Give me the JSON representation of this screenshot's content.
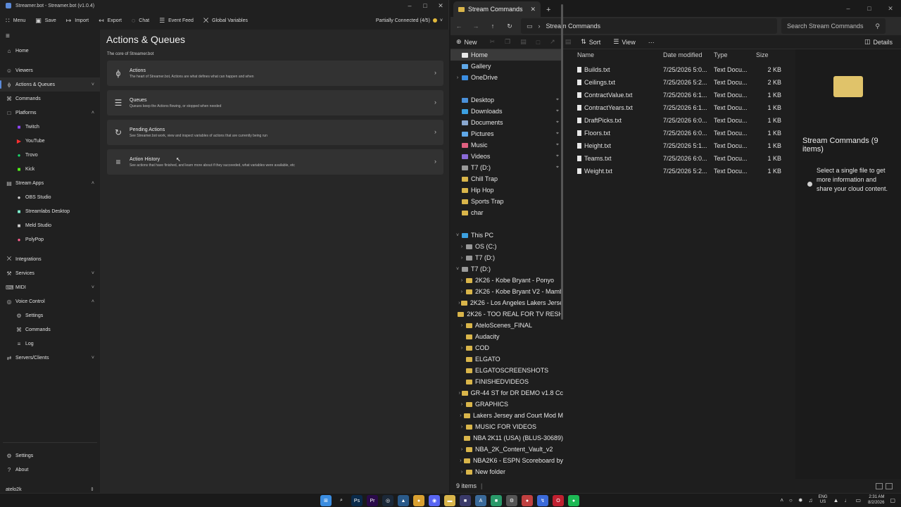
{
  "streamerbot": {
    "title": "Streamer.bot - Streamer.bot (v1.0.4)",
    "toolbar": [
      {
        "icon": "menu-icon",
        "glyph": "∷",
        "label": "Menu"
      },
      {
        "icon": "save-icon",
        "glyph": "▣",
        "label": "Save"
      },
      {
        "icon": "import-icon",
        "glyph": "↦",
        "label": "Import"
      },
      {
        "icon": "export-icon",
        "glyph": "↤",
        "label": "Export"
      },
      {
        "icon": "chat-icon",
        "glyph": "◌",
        "label": "Chat"
      },
      {
        "icon": "event-feed-icon",
        "glyph": "☰",
        "label": "Event Feed"
      },
      {
        "icon": "global-variables-icon",
        "glyph": "⨉",
        "label": "Global Variables"
      }
    ],
    "connection": "Partially Connected (4/5)",
    "sidebar": {
      "items": [
        {
          "key": "home",
          "label": "Home",
          "icon": "home-icon",
          "glyph": "⌂"
        },
        {
          "key": "gap"
        },
        {
          "key": "viewers",
          "label": "Viewers",
          "icon": "viewers-icon",
          "glyph": "☺"
        },
        {
          "key": "actions-queues",
          "label": "Actions & Queues",
          "icon": "actions-icon",
          "glyph": "ϕ",
          "chev": "˅",
          "active": true
        },
        {
          "key": "commands",
          "label": "Commands",
          "icon": "commands-icon",
          "glyph": "⌘"
        },
        {
          "key": "platforms",
          "label": "Platforms",
          "icon": "platforms-icon",
          "glyph": "□",
          "chev": "˄"
        },
        {
          "key": "twitch",
          "label": "Twitch",
          "icon": "twitch-icon",
          "glyph": "■",
          "sub": true,
          "color": "#9146ff"
        },
        {
          "key": "youtube",
          "label": "YouTube",
          "icon": "youtube-icon",
          "glyph": "▶",
          "sub": true,
          "color": "#ff3030"
        },
        {
          "key": "trovo",
          "label": "Trovo",
          "icon": "trovo-icon",
          "glyph": "●",
          "sub": true,
          "color": "#19d66b"
        },
        {
          "key": "kick",
          "label": "Kick",
          "icon": "kick-icon",
          "glyph": "■",
          "sub": true,
          "color": "#53fc18"
        },
        {
          "key": "stream-apps",
          "label": "Stream Apps",
          "icon": "stream-apps-icon",
          "glyph": "▤",
          "chev": "˄"
        },
        {
          "key": "obs",
          "label": "OBS Studio",
          "icon": "obs-icon",
          "glyph": "●",
          "sub": true,
          "color": "#cfcfcf"
        },
        {
          "key": "streamlabs",
          "label": "Streamlabs Desktop",
          "icon": "streamlabs-icon",
          "glyph": "■",
          "sub": true,
          "color": "#80f5d2"
        },
        {
          "key": "meld",
          "label": "Meld Studio",
          "icon": "meld-icon",
          "glyph": "■",
          "sub": true,
          "color": "#cfcfcf"
        },
        {
          "key": "polypop",
          "label": "PolyPop",
          "icon": "polypop-icon",
          "glyph": "●",
          "sub": true,
          "color": "#ff5f8f"
        },
        {
          "key": "gap"
        },
        {
          "key": "integrations",
          "label": "Integrations",
          "icon": "integrations-icon",
          "glyph": "⨉"
        },
        {
          "key": "services",
          "label": "Services",
          "icon": "services-icon",
          "glyph": "⚒",
          "chev": "˅"
        },
        {
          "key": "midi",
          "label": "MIDI",
          "icon": "midi-icon",
          "glyph": "⌨",
          "chev": "˅"
        },
        {
          "key": "voice-control",
          "label": "Voice Control",
          "icon": "voice-control-icon",
          "glyph": "◎",
          "chev": "˄"
        },
        {
          "key": "vc-settings",
          "label": "Settings",
          "icon": "voice-settings-icon",
          "glyph": "⚙",
          "sub": true
        },
        {
          "key": "vc-commands",
          "label": "Commands",
          "icon": "voice-commands-icon",
          "glyph": "⌘",
          "sub": true
        },
        {
          "key": "vc-log",
          "label": "Log",
          "icon": "voice-log-icon",
          "glyph": "≡",
          "sub": true
        },
        {
          "key": "servers",
          "label": "Servers/Clients",
          "icon": "servers-icon",
          "glyph": "⇄",
          "chev": "˅"
        }
      ],
      "bottom": [
        {
          "key": "settings",
          "label": "Settings",
          "icon": "settings-icon",
          "glyph": "⚙"
        },
        {
          "key": "about",
          "label": "About",
          "icon": "about-icon",
          "glyph": "?"
        }
      ],
      "user": "atelo2k"
    },
    "main": {
      "title": "Actions & Queues",
      "subtitle": "The core of Streamer.bot",
      "cards": [
        {
          "icon": "actions-card-icon",
          "glyph": "ϕ",
          "title": "Actions",
          "desc": "The heart of Streamer.bot, Actions are what defines what can happen and when"
        },
        {
          "icon": "queues-card-icon",
          "glyph": "☰",
          "title": "Queues",
          "desc": "Queues keep the Actions flowing, or stopped when needed"
        },
        {
          "icon": "pending-actions-card-icon",
          "glyph": "↻",
          "title": "Pending Actions",
          "desc": "See Streamer.bot work, view and inspect variables of actions that are currently being run"
        },
        {
          "icon": "action-history-card-icon",
          "glyph": "≡",
          "title": "Action History",
          "desc": "See actions that have finished, and learn more about if they succeeded, what variables were available, etc"
        }
      ]
    }
  },
  "explorer": {
    "tab": "Stream Commands",
    "path": "Stream Commands",
    "search_placeholder": "Search Stream Commands",
    "commands": {
      "new": "New",
      "sort": "Sort",
      "view": "View",
      "more": "···",
      "details": "Details"
    },
    "nav_quick": [
      {
        "label": "Home",
        "icon": "home-icon",
        "color": "#e8e8e8",
        "sel": true
      },
      {
        "label": "Gallery",
        "icon": "gallery-icon",
        "color": "#5fa8e8"
      },
      {
        "label": "OneDrive",
        "icon": "onedrive-icon",
        "color": "#3b8de0",
        "arrow": true
      }
    ],
    "nav_pinned": [
      {
        "label": "Desktop",
        "icon": "desktop-icon",
        "color": "#4a90d9",
        "pin": true
      },
      {
        "label": "Downloads",
        "icon": "downloads-icon",
        "color": "#3ca0e0",
        "pin": true
      },
      {
        "label": "Documents",
        "icon": "documents-icon",
        "color": "#8aa8d0",
        "pin": true
      },
      {
        "label": "Pictures",
        "icon": "pictures-icon",
        "color": "#5fa8e8",
        "pin": true
      },
      {
        "label": "Music",
        "icon": "music-icon",
        "color": "#e06080",
        "pin": true
      },
      {
        "label": "Videos",
        "icon": "videos-icon",
        "color": "#8a6ad8",
        "pin": true
      },
      {
        "label": "T7 (D:)",
        "icon": "drive-icon",
        "color": "#999",
        "pin": true
      },
      {
        "label": "Chill Trap",
        "icon": "folder-icon",
        "color": "#d9b54a"
      },
      {
        "label": "Hip Hop",
        "icon": "folder-icon",
        "color": "#d9b54a"
      },
      {
        "label": "Sports Trap",
        "icon": "folder-icon",
        "color": "#d9b54a"
      },
      {
        "label": "char",
        "icon": "folder-icon",
        "color": "#d9b54a"
      }
    ],
    "nav_pc": [
      {
        "label": "This PC",
        "icon": "this-pc-icon",
        "color": "#3ca0e0",
        "arrow": "˅",
        "indent": 0
      },
      {
        "label": "OS (C:)",
        "icon": "drive-icon",
        "color": "#999",
        "arrow": "›",
        "indent": 1
      },
      {
        "label": "T7 (D:)",
        "icon": "drive-icon",
        "color": "#999",
        "arrow": "›",
        "indent": 1
      },
      {
        "label": "T7 (D:)",
        "icon": "drive-icon",
        "color": "#999",
        "arrow": "˅",
        "indent": 0
      },
      {
        "label": "2K26 - Kobe Bryant - Ponyo",
        "icon": "folder-icon",
        "color": "#d9b54a",
        "arrow": "›",
        "indent": 1
      },
      {
        "label": "2K26 - Kobe Bryant V2 - Mamb",
        "icon": "folder-icon",
        "color": "#d9b54a",
        "arrow": "›",
        "indent": 1
      },
      {
        "label": "2K26 - Los Angeles Lakers Jerse",
        "icon": "folder-icon",
        "color": "#d9b54a",
        "arrow": "›",
        "indent": 1
      },
      {
        "label": "2K26 - TOO REAL FOR TV RESH",
        "icon": "folder-icon",
        "color": "#d9b54a",
        "arrow": "",
        "indent": 1
      },
      {
        "label": "AteloScenes_FINAL",
        "icon": "folder-icon",
        "color": "#d9b54a",
        "arrow": "›",
        "indent": 1
      },
      {
        "label": "Audacity",
        "icon": "folder-icon",
        "color": "#d9b54a",
        "arrow": "",
        "indent": 1
      },
      {
        "label": "COD",
        "icon": "folder-icon",
        "color": "#d9b54a",
        "arrow": "›",
        "indent": 1
      },
      {
        "label": "ELGATO",
        "icon": "folder-icon",
        "color": "#d9b54a",
        "arrow": "",
        "indent": 1
      },
      {
        "label": "ELGATOSCREENSHOTS",
        "icon": "folder-icon",
        "color": "#d9b54a",
        "arrow": "",
        "indent": 1
      },
      {
        "label": "FINISHEDVIDEOS",
        "icon": "folder-icon",
        "color": "#d9b54a",
        "arrow": "",
        "indent": 1
      },
      {
        "label": "GR-44 ST for DR DEMO v1.8 Cc",
        "icon": "folder-icon",
        "color": "#d9b54a",
        "arrow": "›",
        "indent": 1
      },
      {
        "label": "GRAPHICS",
        "icon": "folder-icon",
        "color": "#d9b54a",
        "arrow": "›",
        "indent": 1
      },
      {
        "label": "Lakers Jersey and Court Mod M",
        "icon": "folder-icon",
        "color": "#d9b54a",
        "arrow": "›",
        "indent": 1
      },
      {
        "label": "MUSIC FOR VIDEOS",
        "icon": "folder-icon",
        "color": "#d9b54a",
        "arrow": "›",
        "indent": 1
      },
      {
        "label": "NBA 2K11 (USA) (BLUS-30689)",
        "icon": "folder-icon",
        "color": "#d9b54a",
        "arrow": "",
        "indent": 1
      },
      {
        "label": "NBA_2K_Content_Vault_v2",
        "icon": "folder-icon",
        "color": "#d9b54a",
        "arrow": "›",
        "indent": 1
      },
      {
        "label": "NBA2K6 - ESPN Scoreboard by",
        "icon": "folder-icon",
        "color": "#d9b54a",
        "arrow": "›",
        "indent": 1
      },
      {
        "label": "New folder",
        "icon": "folder-icon",
        "color": "#d9b54a",
        "arrow": "›",
        "indent": 1
      }
    ],
    "columns": {
      "name": "Name",
      "date": "Date modified",
      "type": "Type",
      "size": "Size"
    },
    "files": [
      {
        "name": "Builds.txt",
        "date": "7/25/2026 5:0...",
        "type": "Text Docu...",
        "size": "2 KB"
      },
      {
        "name": "Ceilings.txt",
        "date": "7/25/2026 5:2...",
        "type": "Text Docu...",
        "size": "2 KB"
      },
      {
        "name": "ContractValue.txt",
        "date": "7/25/2026 6:1...",
        "type": "Text Docu...",
        "size": "1 KB"
      },
      {
        "name": "ContractYears.txt",
        "date": "7/25/2026 6:1...",
        "type": "Text Docu...",
        "size": "1 KB"
      },
      {
        "name": "DraftPicks.txt",
        "date": "7/25/2026 6:0...",
        "type": "Text Docu...",
        "size": "1 KB"
      },
      {
        "name": "Floors.txt",
        "date": "7/25/2026 6:0...",
        "type": "Text Docu...",
        "size": "1 KB"
      },
      {
        "name": "Height.txt",
        "date": "7/25/2026 5:1...",
        "type": "Text Docu...",
        "size": "1 KB"
      },
      {
        "name": "Teams.txt",
        "date": "7/25/2026 6:0...",
        "type": "Text Docu...",
        "size": "1 KB"
      },
      {
        "name": "Weight.txt",
        "date": "7/25/2026 5:2...",
        "type": "Text Docu...",
        "size": "1 KB"
      }
    ],
    "details_title": "Stream Commands (9 items)",
    "details_info": "Select a single file to get more information and share your cloud content.",
    "status": "9 items"
  },
  "taskbar": {
    "icons": [
      {
        "name": "start-icon",
        "glyph": "⊞",
        "color": "#3b8de0"
      },
      {
        "name": "search-icon",
        "glyph": "⌕",
        "color": "transparent"
      },
      {
        "name": "photoshop-icon",
        "glyph": "Ps",
        "color": "#0a2a4a"
      },
      {
        "name": "premiere-icon",
        "glyph": "Pr",
        "color": "#2a0a4a"
      },
      {
        "name": "steam-icon",
        "glyph": "◎",
        "color": "#1b2838"
      },
      {
        "name": "steam-client-icon",
        "glyph": "▲",
        "color": "#2a5a8a"
      },
      {
        "name": "chrome-icon",
        "glyph": "●",
        "color": "#d9a030"
      },
      {
        "name": "discord-icon",
        "glyph": "◉",
        "color": "#5865f2"
      },
      {
        "name": "file-explorer-icon",
        "glyph": "▬",
        "color": "#d9b54a"
      },
      {
        "name": "app-icon",
        "glyph": "■",
        "color": "#3a3a6a"
      },
      {
        "name": "notepad-icon",
        "glyph": "A",
        "color": "#3a6a9a"
      },
      {
        "name": "terminal-icon",
        "glyph": "■",
        "color": "#2a9a6a"
      },
      {
        "name": "settings-app-icon",
        "glyph": "⚙",
        "color": "#555"
      },
      {
        "name": "chrome-2-icon",
        "glyph": "●",
        "color": "#c04040"
      },
      {
        "name": "streamerbot-icon",
        "glyph": "↯",
        "color": "#3b6ad9"
      },
      {
        "name": "opera-icon",
        "glyph": "O",
        "color": "#c02030"
      },
      {
        "name": "spotify-icon",
        "glyph": "●",
        "color": "#1db954"
      }
    ],
    "lang": "ENG",
    "region": "US",
    "time": "2:31 AM",
    "date": "8/2/2026"
  }
}
